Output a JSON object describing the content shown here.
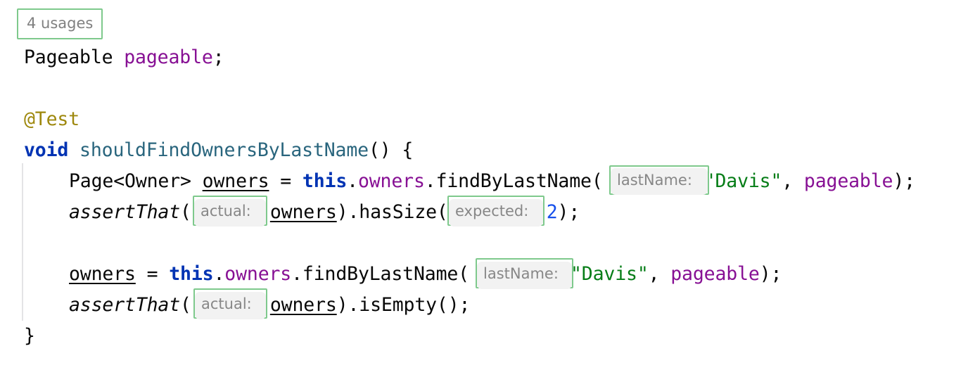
{
  "editor": {
    "background": "#ffffff",
    "indent_guide_color": "#e4e4e6",
    "hint_border_color": "#7ec98c",
    "inlay_pill_background": "#f2f2f2",
    "inlay_text_color": "#878787"
  },
  "usage_hint": {
    "label": "4 usages"
  },
  "colors": {
    "plain": "#080808",
    "keyword": "#0033b3",
    "field": "#871094",
    "annotation": "#9e880d",
    "method": "#29657d",
    "string": "#067d17",
    "number": "#1750eb"
  },
  "code": {
    "line1": {
      "type": "Pageable",
      "space": " ",
      "name": "pageable",
      "semi": ";"
    },
    "line2": {
      "annotation": "@Test"
    },
    "line3": {
      "keyword": "void",
      "space": " ",
      "method": "shouldFindOwnersByLastName",
      "tail": "() {"
    },
    "line4": {
      "type": "Page<Owner> ",
      "var": "owners",
      "assign": " = ",
      "this": "this",
      "dot1": ".",
      "field": "owners",
      "dot2": ".",
      "call": "findByLastName(",
      "string": "\"Davis\"",
      "comma": ", ",
      "arg": "pageable",
      "tail": ");"
    },
    "line5": {
      "static_call": "assertThat",
      "paren": "(",
      "var": "owners",
      "mid": ").hasSize(",
      "number": "2",
      "tail": ");"
    },
    "line6": {
      "var": "owners",
      "assign": " = ",
      "this": "this",
      "dot1": ".",
      "field": "owners",
      "dot2": ".",
      "call": "findByLastName(",
      "string": "\"Davis\"",
      "comma": ", ",
      "arg": "pageable",
      "tail": ");"
    },
    "line7": {
      "static_call": "assertThat",
      "paren": "(",
      "var": "owners",
      "tail": ").isEmpty();"
    },
    "line8": {
      "brace": "}"
    }
  },
  "inlay_hints": {
    "hint1": "lastName:",
    "hint2": "actual:",
    "hint3": "expected:",
    "hint4": "lastName:",
    "hint5": "actual:"
  }
}
